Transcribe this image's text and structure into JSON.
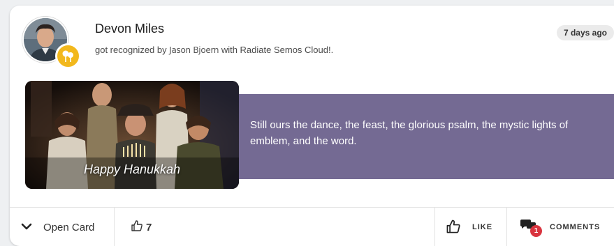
{
  "post": {
    "author_name": "Devon Miles",
    "action_prefix": "got recognized by",
    "recognizer": "Jason Bjoern",
    "action_suffix": "with Radiate Semos Cloud!.",
    "time_ago": "7 days ago",
    "message": "Still ours the dance, the feast, the glorious psalm, the mystic lights of emblem, and the word.",
    "ecard_caption": "Happy Hanukkah",
    "badge_icon": "award-icon",
    "colors": {
      "message_bg": "#746a93",
      "badge": "#f2b81d",
      "comment_badge": "#d9343f"
    }
  },
  "footer": {
    "open_card_label": "Open Card",
    "likes_count": "7",
    "like_label": "LIKE",
    "comments_label": "COMMENTS",
    "comments_count": "1"
  }
}
